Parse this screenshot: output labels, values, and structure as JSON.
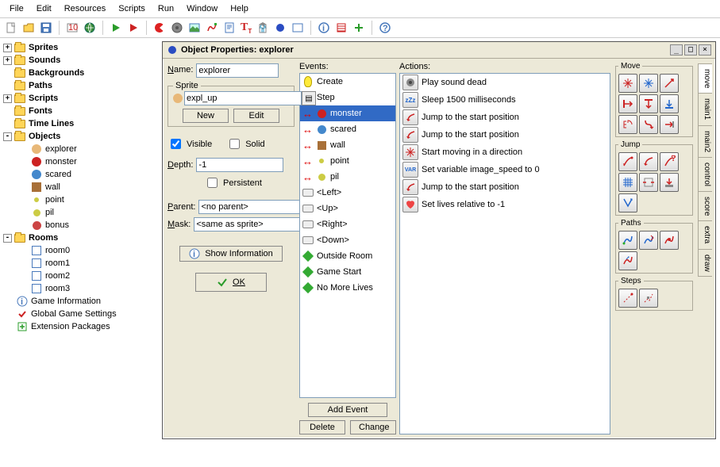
{
  "menu": [
    "File",
    "Edit",
    "Resources",
    "Scripts",
    "Run",
    "Window",
    "Help"
  ],
  "tree": {
    "folders": [
      "Sprites",
      "Sounds",
      "Backgrounds",
      "Paths",
      "Scripts",
      "Fonts",
      "Time Lines",
      "Objects",
      "Rooms"
    ],
    "objects": [
      "explorer",
      "monster",
      "scared",
      "wall",
      "point",
      "pil",
      "bonus"
    ],
    "rooms": [
      "room0",
      "room1",
      "room2",
      "room3"
    ],
    "bottom": [
      "Game Information",
      "Global Game Settings",
      "Extension Packages"
    ]
  },
  "dlg": {
    "title": "Object Properties: explorer",
    "name_lbl": "Name:",
    "name_val": "explorer",
    "sprite_grp": "Sprite",
    "sprite_val": "expl_up",
    "btn_new": "New",
    "btn_edit": "Edit",
    "chk_visible": "Visible",
    "chk_solid": "Solid",
    "depth_lbl": "Depth:",
    "depth_val": "-1",
    "chk_persist": "Persistent",
    "parent_lbl": "Parent:",
    "parent_val": "<no parent>",
    "mask_lbl": "Mask:",
    "mask_val": "<same as sprite>",
    "btn_info": "Show Information",
    "btn_ok": "OK",
    "events_lbl": "Events:",
    "events": [
      "Create",
      "Step",
      "monster",
      "scared",
      "wall",
      "point",
      "pil",
      "<Left>",
      "<Up>",
      "<Right>",
      "<Down>",
      "Outside Room",
      "Game Start",
      "No More Lives"
    ],
    "btn_addevt": "Add Event",
    "btn_delete": "Delete",
    "btn_change": "Change",
    "actions_lbl": "Actions:",
    "actions": [
      "Play sound dead",
      "Sleep 1500 milliseconds",
      "Jump to the start position",
      "Jump to the start position",
      "Start moving in a direction",
      "Set variable image_speed to 0",
      "Jump to the start position",
      "Set lives relative to -1"
    ],
    "pal": {
      "move": "Move",
      "jump": "Jump",
      "paths": "Paths",
      "steps": "Steps"
    },
    "tabs": [
      "move",
      "main1",
      "main2",
      "control",
      "score",
      "extra",
      "draw"
    ]
  }
}
